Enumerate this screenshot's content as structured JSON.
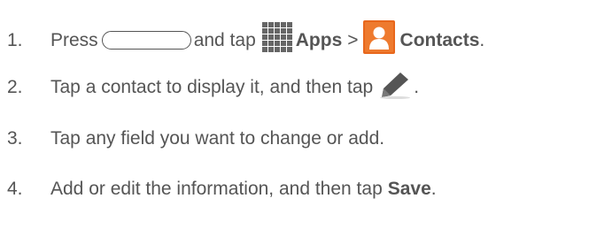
{
  "steps": [
    {
      "number": "1.",
      "text_press": "Press",
      "text_and_tap": "and tap",
      "apps_label": "Apps",
      "separator": ">",
      "contacts_label": "Contacts",
      "end": "."
    },
    {
      "number": "2.",
      "text": "Tap a contact to display it, and then tap",
      "end": "."
    },
    {
      "number": "3.",
      "text": "Tap any field you want to change or add."
    },
    {
      "number": "4.",
      "text": "Add or edit the information, and then tap",
      "save_label": "Save",
      "end": "."
    }
  ],
  "icons": {
    "home_key": "home-key-icon",
    "apps": "apps-grid-icon",
    "contacts": "contacts-icon",
    "edit": "pencil-edit-icon"
  },
  "colors": {
    "text": "#555555",
    "icon_gray": "#666666",
    "contacts_orange": "#E8671C"
  }
}
